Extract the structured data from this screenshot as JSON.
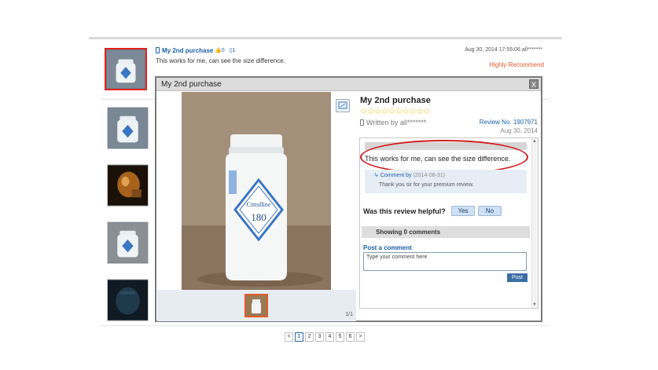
{
  "review": {
    "title": "My 2nd purchase",
    "likes": "0",
    "comments_count": "1",
    "text": "This works for me, can see the size difference.",
    "date": "Aug 30, 2014 17:55:06",
    "author": "all*******",
    "recommend": "Highly Recommend"
  },
  "modal": {
    "header": "My 2nd purchase",
    "close": "X",
    "title": "My 2nd purchase",
    "stars": "☆☆☆☆☆☆☆☆☆☆",
    "written_by": "Written by all*******",
    "review_no": "Review No. 1907971",
    "date": "Aug 30, 2014",
    "review_text": "This works for me, can see the size difference.",
    "comment_author": "Comment by",
    "comment_meta": "(2014-08-31)",
    "comment_text": "Thank you sir for your premium review.",
    "helpful_q": "Was this review helpful?",
    "yes": "Yes",
    "no": "No",
    "showing": "Showing 0 comments",
    "post_label": "Post a comment",
    "comment_placeholder": "Type your comment here",
    "post_btn": "Post",
    "image_count": "1/1"
  },
  "bottle": {
    "brand": "Citrulline",
    "count": "180"
  },
  "pager": {
    "prev": "<",
    "pages": [
      "1",
      "2",
      "3",
      "4",
      "5",
      "6"
    ],
    "next": ">"
  },
  "colors": {
    "link": "#1a5faa",
    "recommend": "#e05a2b",
    "highlight_ellipse": "#d11f1f",
    "star": "#f5b900"
  },
  "icons": [
    "phone-icon",
    "thumbs-up-icon",
    "comment-icon",
    "zoom-icon",
    "close-icon",
    "reply-arrow-icon"
  ]
}
